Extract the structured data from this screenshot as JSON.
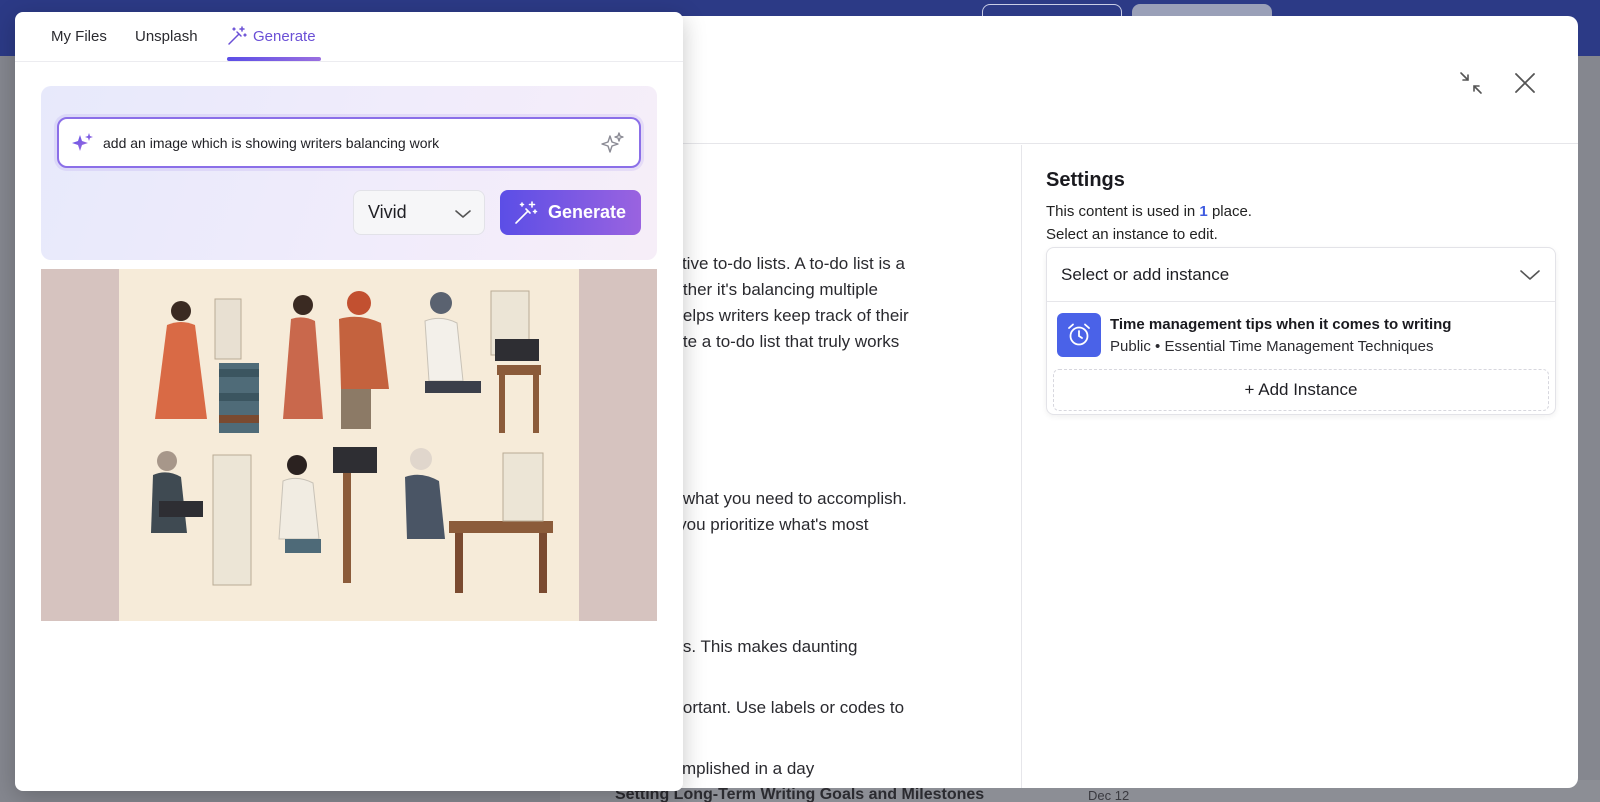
{
  "background": {
    "bottom_heading": "Setting Long-Term Writing Goals and Milestones",
    "bottom_date": "Dec 12"
  },
  "editor": {
    "content_lines": [
      "ective to-do lists. A to-do list is a",
      "hether it's balancing multiple",
      "t helps writers keep track of their",
      "eate a to-do list that truly works",
      "of what you need to accomplish.",
      "g you prioritize what's most",
      "eps. This makes daunting",
      "nportant. Use labels or codes to",
      "complished in a day"
    ],
    "settings": {
      "title": "Settings",
      "usage_prefix": "This content is used in",
      "usage_count": "1",
      "usage_suffix": "place.",
      "instruction": "Select an instance to edit.",
      "instance_select_placeholder": "Select or add instance",
      "instance": {
        "title": "Time management tips when it comes to writing",
        "subtitle": "Public • Essential Time Management Techniques",
        "icon": "alarm-clock-icon"
      },
      "add_instance_label": "+ Add Instance"
    }
  },
  "picker": {
    "tabs": [
      {
        "label": "My Files"
      },
      {
        "label": "Unsplash"
      },
      {
        "label": "Generate",
        "icon": "magic-wand-icon",
        "active": true
      }
    ],
    "prompt": {
      "value": "add an image which is showing writers balancing work"
    },
    "style_select": {
      "selected": "Vivid"
    },
    "generate_button_label": "Generate"
  },
  "colors": {
    "accent": "#5b4ee6",
    "accent_end": "#9a63e0",
    "link_blue": "#3f5be0",
    "instance_icon_bg": "#4a62e8",
    "app_topbar": "#2c3a86"
  }
}
